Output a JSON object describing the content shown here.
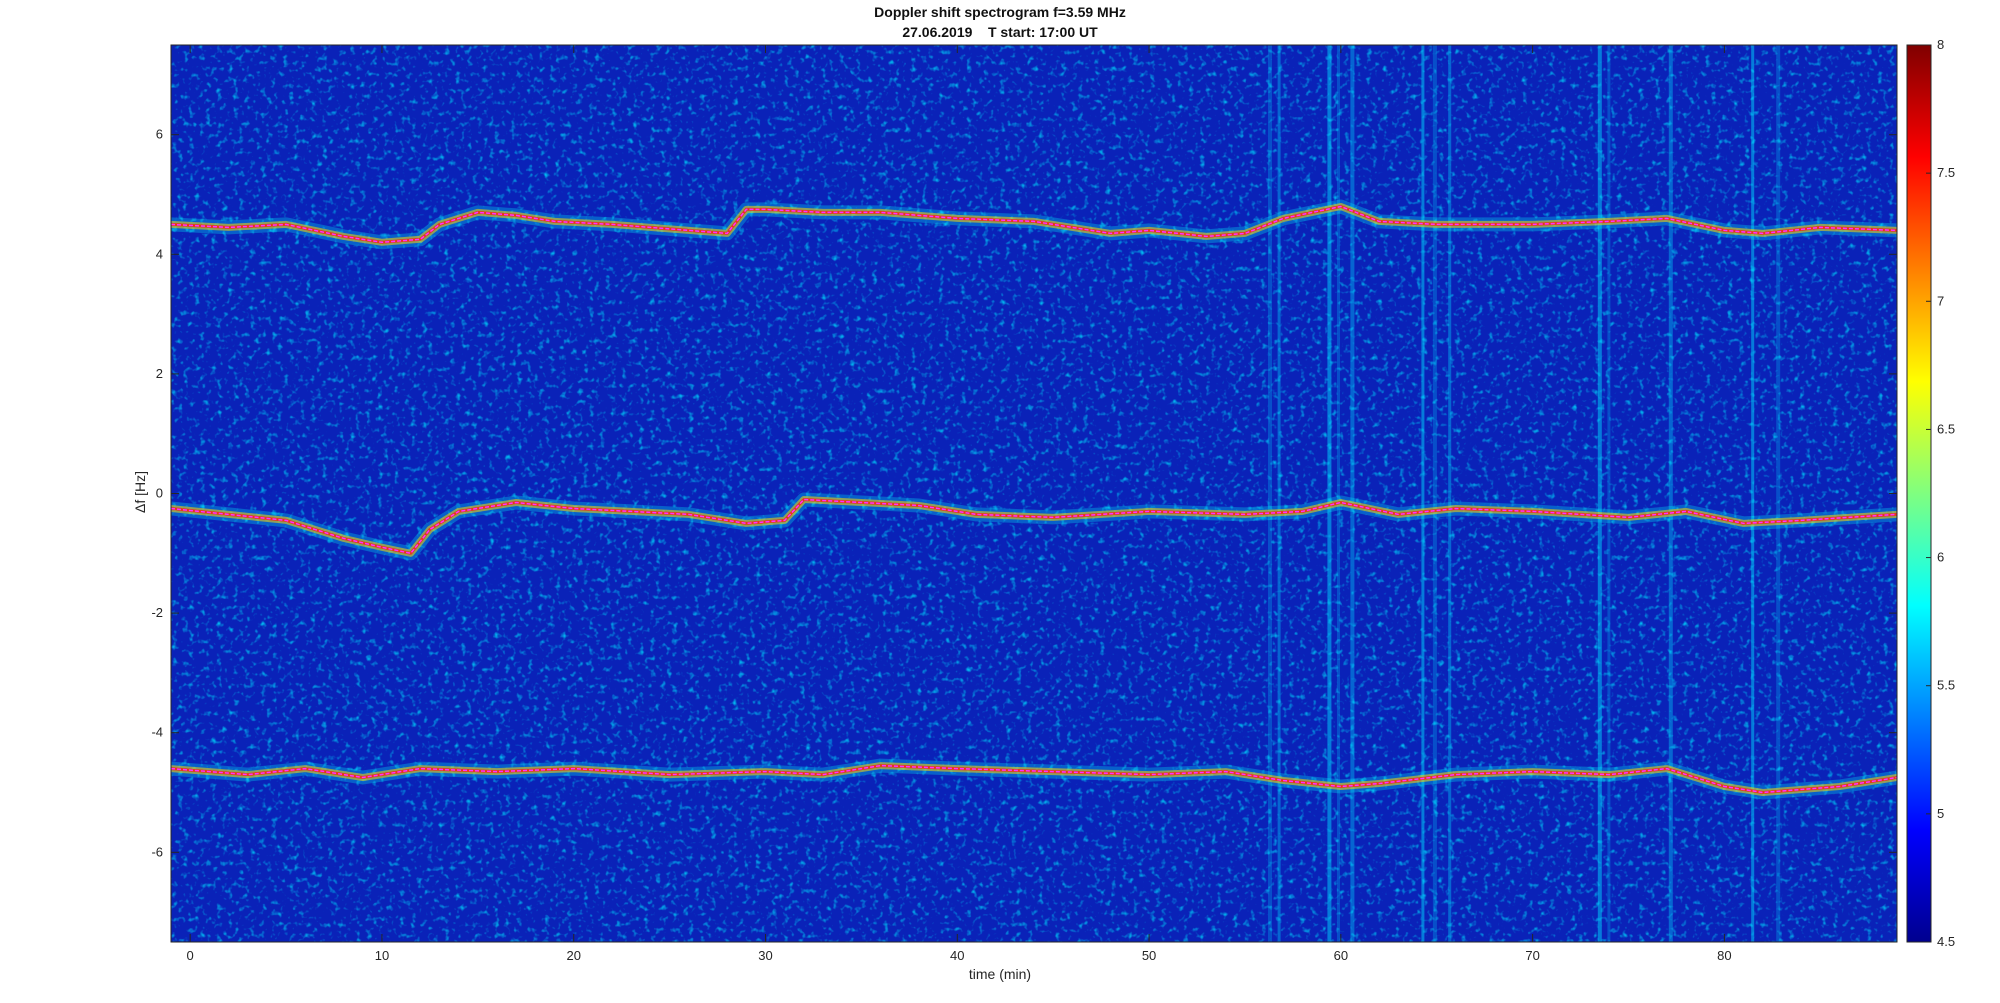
{
  "chart_data": {
    "type": "heatmap",
    "title": "Doppler shift spectrogram f=3.59 MHz",
    "subtitle": "27.06.2019    T start: 17:00 UT",
    "xlabel": "time (min)",
    "ylabel": "Δf [Hz]",
    "xlim": [
      -1,
      89
    ],
    "ylim": [
      -7.5,
      7.5
    ],
    "x_ticks": [
      0,
      10,
      20,
      30,
      40,
      50,
      60,
      70,
      80
    ],
    "y_ticks": [
      -6,
      -4,
      -2,
      0,
      2,
      4,
      6
    ],
    "colorbar": {
      "colormap": "jet",
      "range": [
        4.5,
        8
      ],
      "ticks": [
        4.5,
        5,
        5.5,
        6,
        6.5,
        7,
        7.5,
        8
      ]
    },
    "series": [
      {
        "x": [
          -1,
          2,
          5,
          8,
          10,
          12,
          13,
          15,
          17,
          19,
          22,
          26,
          28,
          29,
          30,
          33,
          36,
          40,
          44,
          48,
          50,
          53,
          55,
          57,
          60,
          62,
          65,
          70,
          74,
          77,
          80,
          82,
          85,
          89
        ],
        "y": [
          4.5,
          4.45,
          4.5,
          4.3,
          4.2,
          4.25,
          4.5,
          4.7,
          4.65,
          4.55,
          4.5,
          4.4,
          4.35,
          4.75,
          4.75,
          4.7,
          4.7,
          4.6,
          4.55,
          4.35,
          4.4,
          4.3,
          4.35,
          4.6,
          4.8,
          4.55,
          4.5,
          4.5,
          4.55,
          4.6,
          4.4,
          4.35,
          4.45,
          4.4
        ]
      },
      {
        "x": [
          -1,
          2,
          5,
          8,
          10,
          11.5,
          12.5,
          14,
          17,
          20,
          23,
          26,
          29,
          31,
          32,
          35,
          38,
          41,
          45,
          50,
          55,
          58,
          60,
          63,
          66,
          70,
          75,
          78,
          81,
          84,
          89
        ],
        "y": [
          -0.25,
          -0.35,
          -0.45,
          -0.75,
          -0.9,
          -1.0,
          -0.6,
          -0.3,
          -0.15,
          -0.25,
          -0.3,
          -0.35,
          -0.5,
          -0.45,
          -0.1,
          -0.15,
          -0.2,
          -0.35,
          -0.4,
          -0.3,
          -0.35,
          -0.3,
          -0.15,
          -0.35,
          -0.25,
          -0.3,
          -0.4,
          -0.3,
          -0.5,
          -0.45,
          -0.35
        ]
      },
      {
        "x": [
          -1,
          3,
          6,
          9,
          12,
          16,
          20,
          25,
          30,
          33,
          36,
          40,
          45,
          50,
          54,
          57,
          60,
          62,
          66,
          70,
          74,
          77,
          80,
          82,
          86,
          89
        ],
        "y": [
          -4.6,
          -4.7,
          -4.6,
          -4.75,
          -4.6,
          -4.65,
          -4.6,
          -4.7,
          -4.65,
          -4.7,
          -4.55,
          -4.6,
          -4.65,
          -4.7,
          -4.65,
          -4.8,
          -4.9,
          -4.85,
          -4.7,
          -4.65,
          -4.7,
          -4.6,
          -4.9,
          -5.0,
          -4.9,
          -4.75
        ]
      }
    ]
  }
}
